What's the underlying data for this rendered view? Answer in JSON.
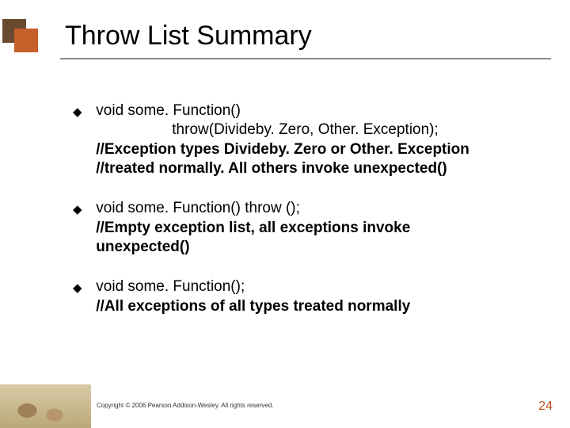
{
  "title": "Throw List Summary",
  "bullets": [
    {
      "line1": "void some. Function()",
      "line2_indent": "throw(Divideby. Zero, Other. Exception);",
      "comment1": "//Exception types Divideby. Zero or Other. Exception",
      "comment2": "//treated normally.  All others invoke unexpected()"
    },
    {
      "line1": "void some. Function() throw ();",
      "comment1": "//Empty exception list, all exceptions invoke",
      "comment2": "unexpected()"
    },
    {
      "line1": "void some. Function();",
      "comment1": "//All exceptions of all types treated normally"
    }
  ],
  "copyright": "Copyright © 2006 Pearson Addison-Wesley. All rights reserved.",
  "page_number": "24",
  "glyph": "◆"
}
